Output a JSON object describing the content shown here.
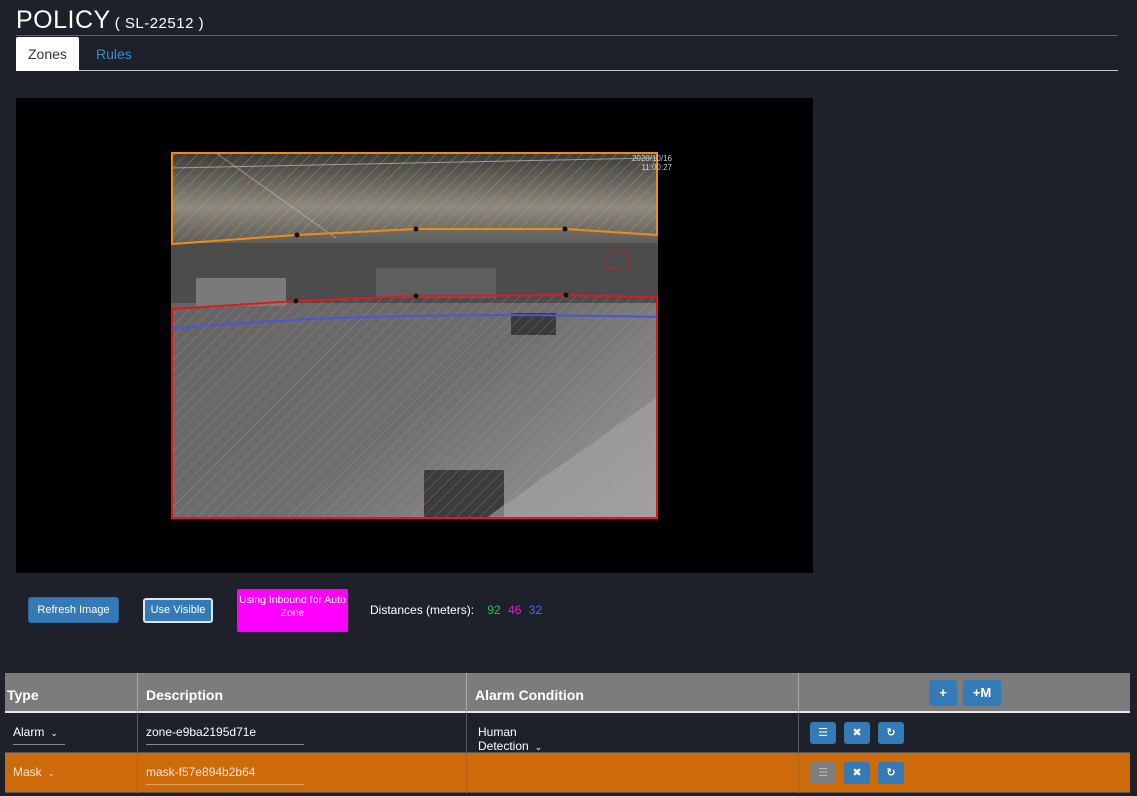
{
  "header": {
    "title": "POLICY",
    "subtitle": "( SL-22512 )"
  },
  "tabs": [
    {
      "label": "Zones",
      "active": true
    },
    {
      "label": "Rules",
      "active": false
    }
  ],
  "viewer": {
    "timestamp_line1": "2020/10/16",
    "timestamp_line2": "11:00:27"
  },
  "controls": {
    "refresh_label": "Refresh Image",
    "visible_label": "Use Visible",
    "auto_zone_label": "Using Inbound for Auto Zone",
    "distances_label": "Distances (meters):",
    "distance_values": [
      "92",
      "46",
      "32"
    ]
  },
  "table": {
    "headers": {
      "type": "Type",
      "description": "Description",
      "alarm_condition": "Alarm Condition"
    },
    "add_label": "+",
    "add_multi_label": "+M",
    "rows": [
      {
        "type": "Alarm",
        "description": "zone-e9ba2195d71e",
        "alarm_condition": "Human Detection",
        "kind": "alarm"
      },
      {
        "type": "Mask",
        "description": "mask-f57e894b2b64",
        "alarm_condition": "",
        "kind": "mask"
      }
    ]
  },
  "colors": {
    "accent": "#337ab7",
    "auto_zone": "#ff00ff",
    "mask_row": "#cd6a0a",
    "distance_green": "#2bbf4f",
    "distance_magenta": "#e11ae1",
    "distance_blue": "#4a6df0",
    "zone_orange": "#f08a18",
    "zone_red": "#e01a1a",
    "line_blue": "#4a55d8"
  }
}
